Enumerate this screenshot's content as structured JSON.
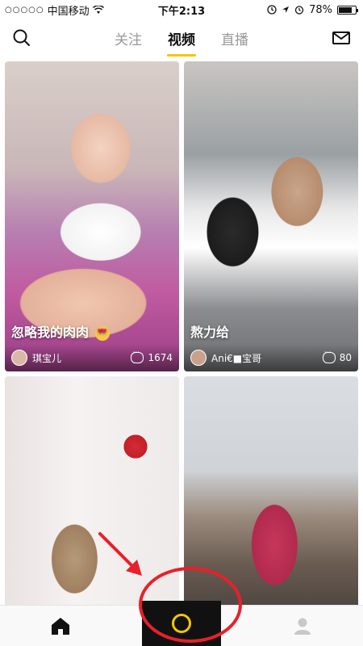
{
  "status_bar": {
    "signal": "○○○○○",
    "carrier": "中国移动",
    "time": "下午2:13",
    "battery": "78%",
    "battery_level": 0.78
  },
  "top_nav": {
    "tabs": [
      {
        "label": "关注",
        "active": false
      },
      {
        "label": "视频",
        "active": true
      },
      {
        "label": "直播",
        "active": false
      }
    ],
    "icons": {
      "left": "search-icon",
      "right": "mail-icon"
    },
    "accent": "#f7c600"
  },
  "feed": [
    {
      "caption": "忽略我的肉肉",
      "emoji": "heart-eyes-emoji",
      "author": "琪宝儿",
      "comments": "1674"
    },
    {
      "caption": "熬力给",
      "author": "Ani€■宝哥",
      "comments": "80"
    },
    {
      "caption": "",
      "author": "",
      "comments": ""
    },
    {
      "caption": "",
      "author": "",
      "comments": ""
    }
  ],
  "tab_bar": {
    "items": [
      {
        "icon": "home-icon"
      },
      {
        "icon": "camera-record-icon"
      },
      {
        "icon": "profile-icon"
      }
    ],
    "camera_ring_color": "#f7c600"
  },
  "annotation": {
    "color": "#e8202a"
  }
}
